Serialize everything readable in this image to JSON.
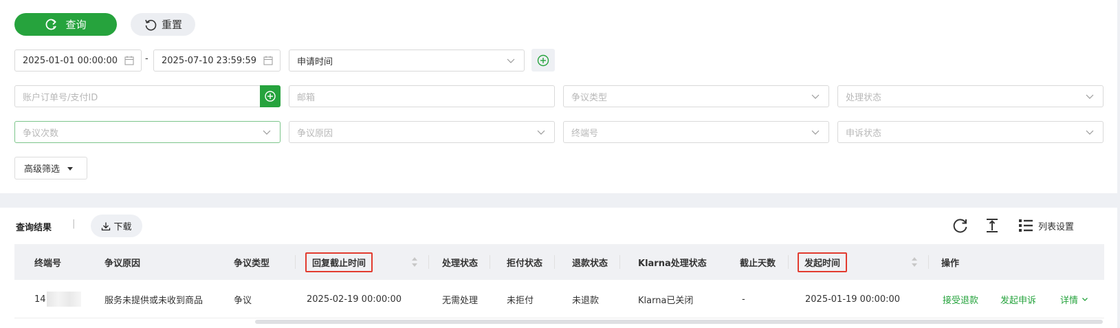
{
  "toolbar": {
    "query_label": "查询",
    "reset_label": "重置"
  },
  "filters": {
    "date_start": "2025-01-01 00:00:00",
    "date_separator": "-",
    "date_end": "2025-07-10 23:59:59",
    "date_type": "申请时间",
    "account_order_placeholder": "账户订单号/支付ID",
    "email_placeholder": "邮箱",
    "dispute_type_placeholder": "争议类型",
    "process_status_placeholder": "处理状态",
    "dispute_count_placeholder": "争议次数",
    "dispute_reason_placeholder": "争议原因",
    "terminal_placeholder": "终端号",
    "appeal_status_placeholder": "申诉状态",
    "advanced_label": "高级筛选"
  },
  "results": {
    "title": "查询结果",
    "separator": "|",
    "download_label": "下载",
    "column_settings_label": "列表设置"
  },
  "table": {
    "headers": {
      "terminal": "终端号",
      "reason": "争议原因",
      "type": "争议类型",
      "reply_deadline": "回复截止时间",
      "process_status": "处理状态",
      "chargeback_status": "拒付状态",
      "refund_status": "退款状态",
      "klarna_status": "Klarna处理状态",
      "days_left": "截止天数",
      "initiated_time": "发起时间",
      "actions": "操作"
    },
    "rows": [
      {
        "terminal": "14",
        "reason": "服务未提供或未收到商品",
        "type": "争议",
        "reply_deadline": "2025-02-19 00:00:00",
        "process_status": "无需处理",
        "chargeback_status": "未拒付",
        "refund_status": "未退款",
        "klarna_status": "Klarna已关闭",
        "days_left": "-",
        "initiated_time": "2025-01-19 00:00:00",
        "action_accept_refund": "接受退款",
        "action_appeal": "发起申诉",
        "action_details": "详情"
      }
    ]
  },
  "colors": {
    "brand_green": "#26a33d",
    "highlight_red": "#e23b2f"
  }
}
